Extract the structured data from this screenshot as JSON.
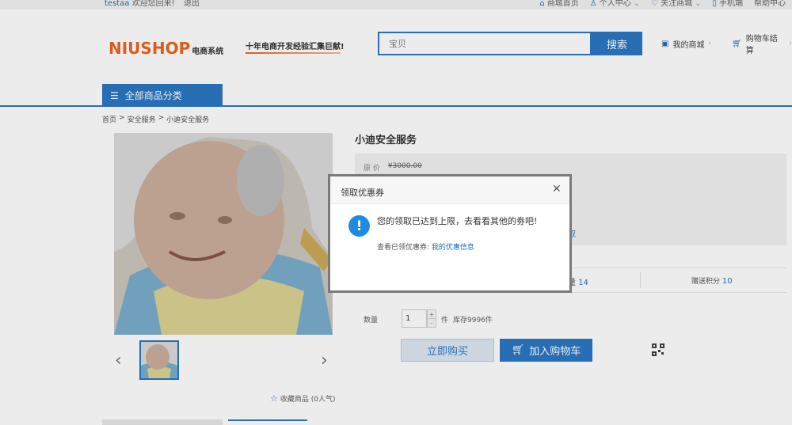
{
  "topbar": {
    "username": "testaa",
    "welcome": "欢迎您回来!",
    "logout": "退出",
    "links": [
      {
        "label": "商城首页",
        "icon": "home-icon"
      },
      {
        "label": "个人中心",
        "icon": "user-icon"
      },
      {
        "label": "关注商城",
        "icon": "heart-icon"
      },
      {
        "label": "手机端",
        "icon": "phone-icon"
      },
      {
        "label": "帮助中心",
        "icon": ""
      }
    ]
  },
  "header": {
    "logo_text": "NIUSHOP",
    "logo_sub": "电商系统",
    "slogan": "十年电商开发经验汇集巨献!",
    "search_placeholder": "宝贝",
    "search_button": "搜索",
    "my_shop": "我的商城",
    "cart": "购物车结算"
  },
  "nav": {
    "category_button": "全部商品分类"
  },
  "breadcrumb": [
    "首页",
    ">",
    "安全服务",
    ">",
    "小迪安全服务"
  ],
  "product": {
    "title": "小迪安全服务",
    "original_price_label": "原 价",
    "original_price": "¥3000.00",
    "coupon_link_fragment": "取",
    "stat_fragment_label": "量",
    "stat_fragment_value": "14",
    "points_label": "赠送积分",
    "points_value": "10",
    "quantity_label": "数量",
    "quantity_value": "1",
    "quantity_unit": "件",
    "stock": "库存9996件",
    "buy_now": "立即购买",
    "add_cart": "加入购物车",
    "favorite": "收藏商品 (0人气)"
  },
  "modal": {
    "title": "领取优惠券",
    "message": "您的领取已达到上限，去看看其他的劵吧!",
    "sub_text": "查看已领优惠券:",
    "sub_link": "我的优惠信息"
  },
  "colors": {
    "brand_blue": "#1a6dbf",
    "logo_orange": "#e85a10",
    "info_blue": "#1f8ae0"
  }
}
